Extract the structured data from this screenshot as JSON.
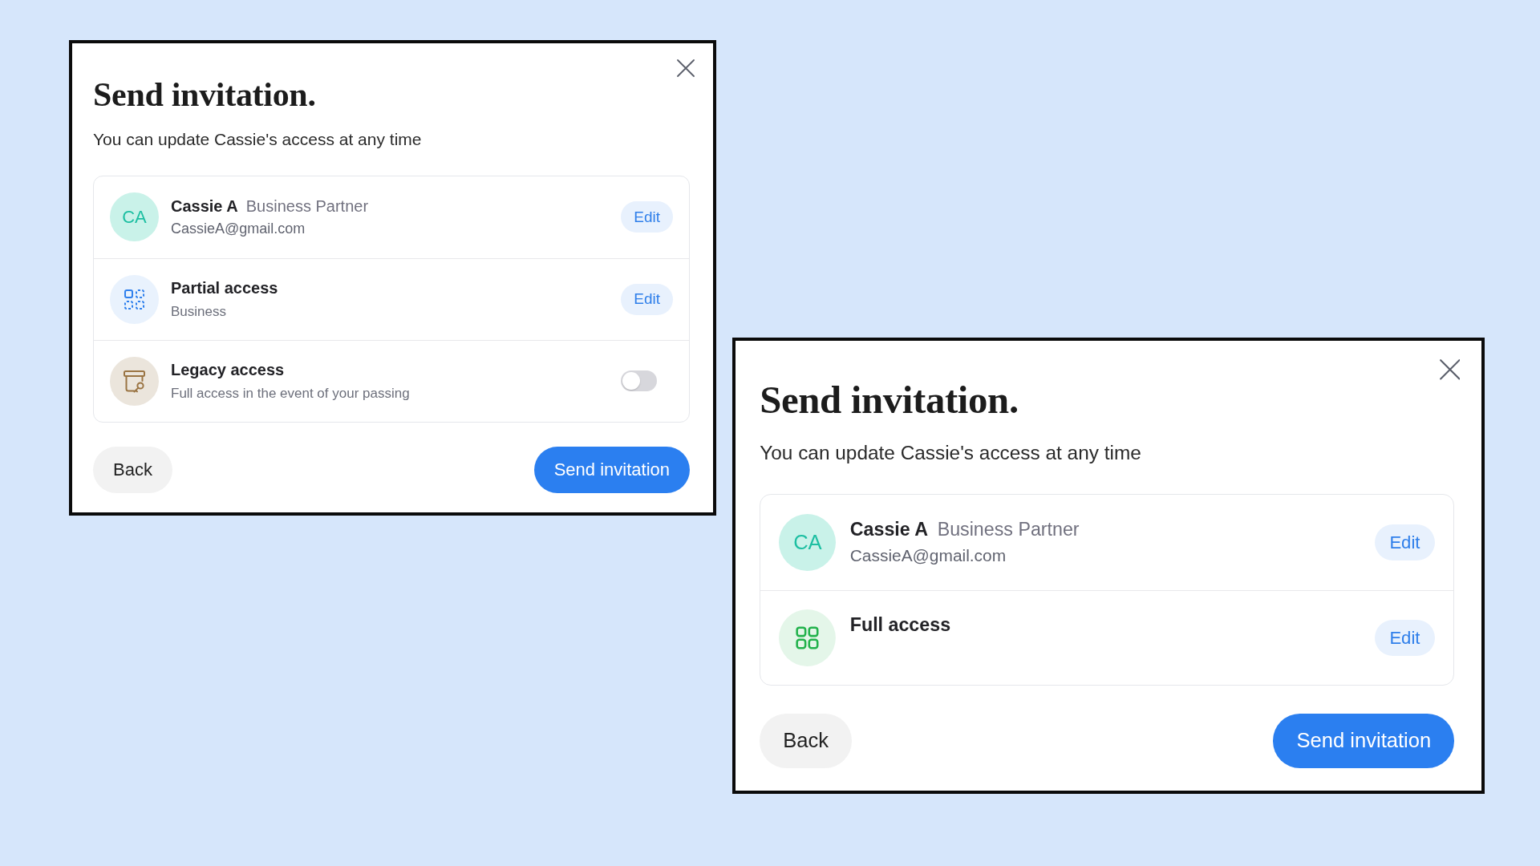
{
  "dialogs": [
    {
      "title": "Send invitation.",
      "subtitle": "You can update Cassie's access at any time",
      "rows": [
        {
          "kind": "person",
          "initials": "CA",
          "name": "Cassie A",
          "role": "Business Partner",
          "email": "CassieA@gmail.com",
          "action": {
            "kind": "button",
            "label": "Edit"
          }
        },
        {
          "kind": "partial",
          "title": "Partial access",
          "subtitle": "Business",
          "action": {
            "kind": "button",
            "label": "Edit"
          }
        },
        {
          "kind": "legacy",
          "title": "Legacy access",
          "subtitle": "Full access in the event of your passing",
          "action": {
            "kind": "switch",
            "on": false
          }
        }
      ],
      "buttons": [
        {
          "kind": "secondary",
          "label": "Back"
        },
        {
          "kind": "primary",
          "label": "Send invitation"
        }
      ]
    },
    {
      "title": "Send invitation.",
      "subtitle": "You can update Cassie's access at any time",
      "rows": [
        {
          "kind": "person",
          "initials": "CA",
          "name": "Cassie A",
          "role": "Business Partner",
          "email": "CassieA@gmail.com",
          "action": {
            "kind": "button",
            "label": "Edit"
          }
        },
        {
          "kind": "full",
          "title": "Full access",
          "action": {
            "kind": "button",
            "label": "Edit"
          }
        }
      ],
      "buttons": [
        {
          "kind": "secondary",
          "label": "Back"
        },
        {
          "kind": "primary",
          "label": "Send invitation"
        }
      ]
    }
  ]
}
